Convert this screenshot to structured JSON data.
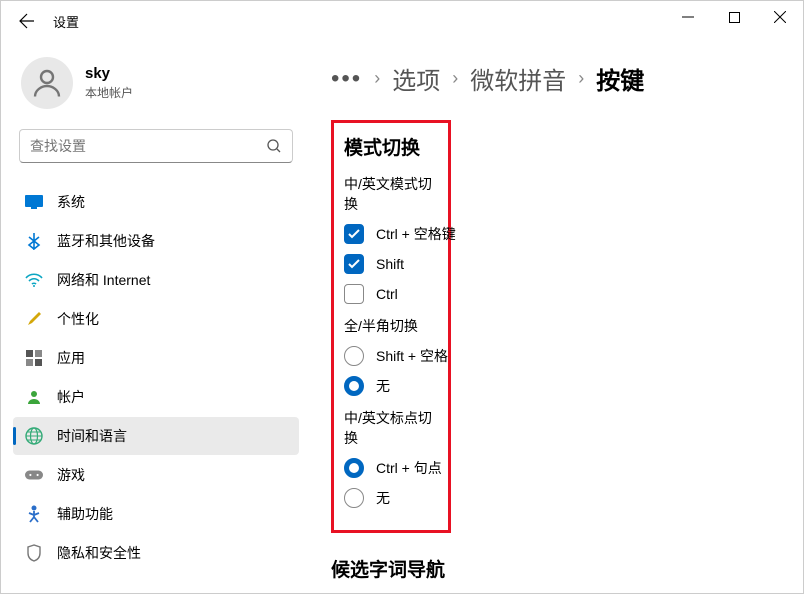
{
  "window": {
    "title": "设置"
  },
  "user": {
    "name": "sky",
    "type": "本地帐户"
  },
  "search": {
    "placeholder": "查找设置"
  },
  "nav": {
    "items": [
      {
        "label": "系统"
      },
      {
        "label": "蓝牙和其他设备"
      },
      {
        "label": "网络和 Internet"
      },
      {
        "label": "个性化"
      },
      {
        "label": "应用"
      },
      {
        "label": "帐户"
      },
      {
        "label": "时间和语言"
      },
      {
        "label": "游戏"
      },
      {
        "label": "辅助功能"
      },
      {
        "label": "隐私和安全性"
      }
    ]
  },
  "breadcrumb": {
    "items": [
      "选项",
      "微软拼音",
      "按键"
    ]
  },
  "main": {
    "section1_title": "模式切换",
    "sub1_label": "中/英文模式切换",
    "sub1_opts": [
      "Ctrl + 空格键",
      "Shift",
      "Ctrl"
    ],
    "sub2_label": "全/半角切换",
    "sub2_opts": [
      "Shift + 空格",
      "无"
    ],
    "sub3_label": "中/英文标点切换",
    "sub3_opts": [
      "Ctrl + 句点",
      "无"
    ],
    "section2_title": "候选字词导航"
  }
}
